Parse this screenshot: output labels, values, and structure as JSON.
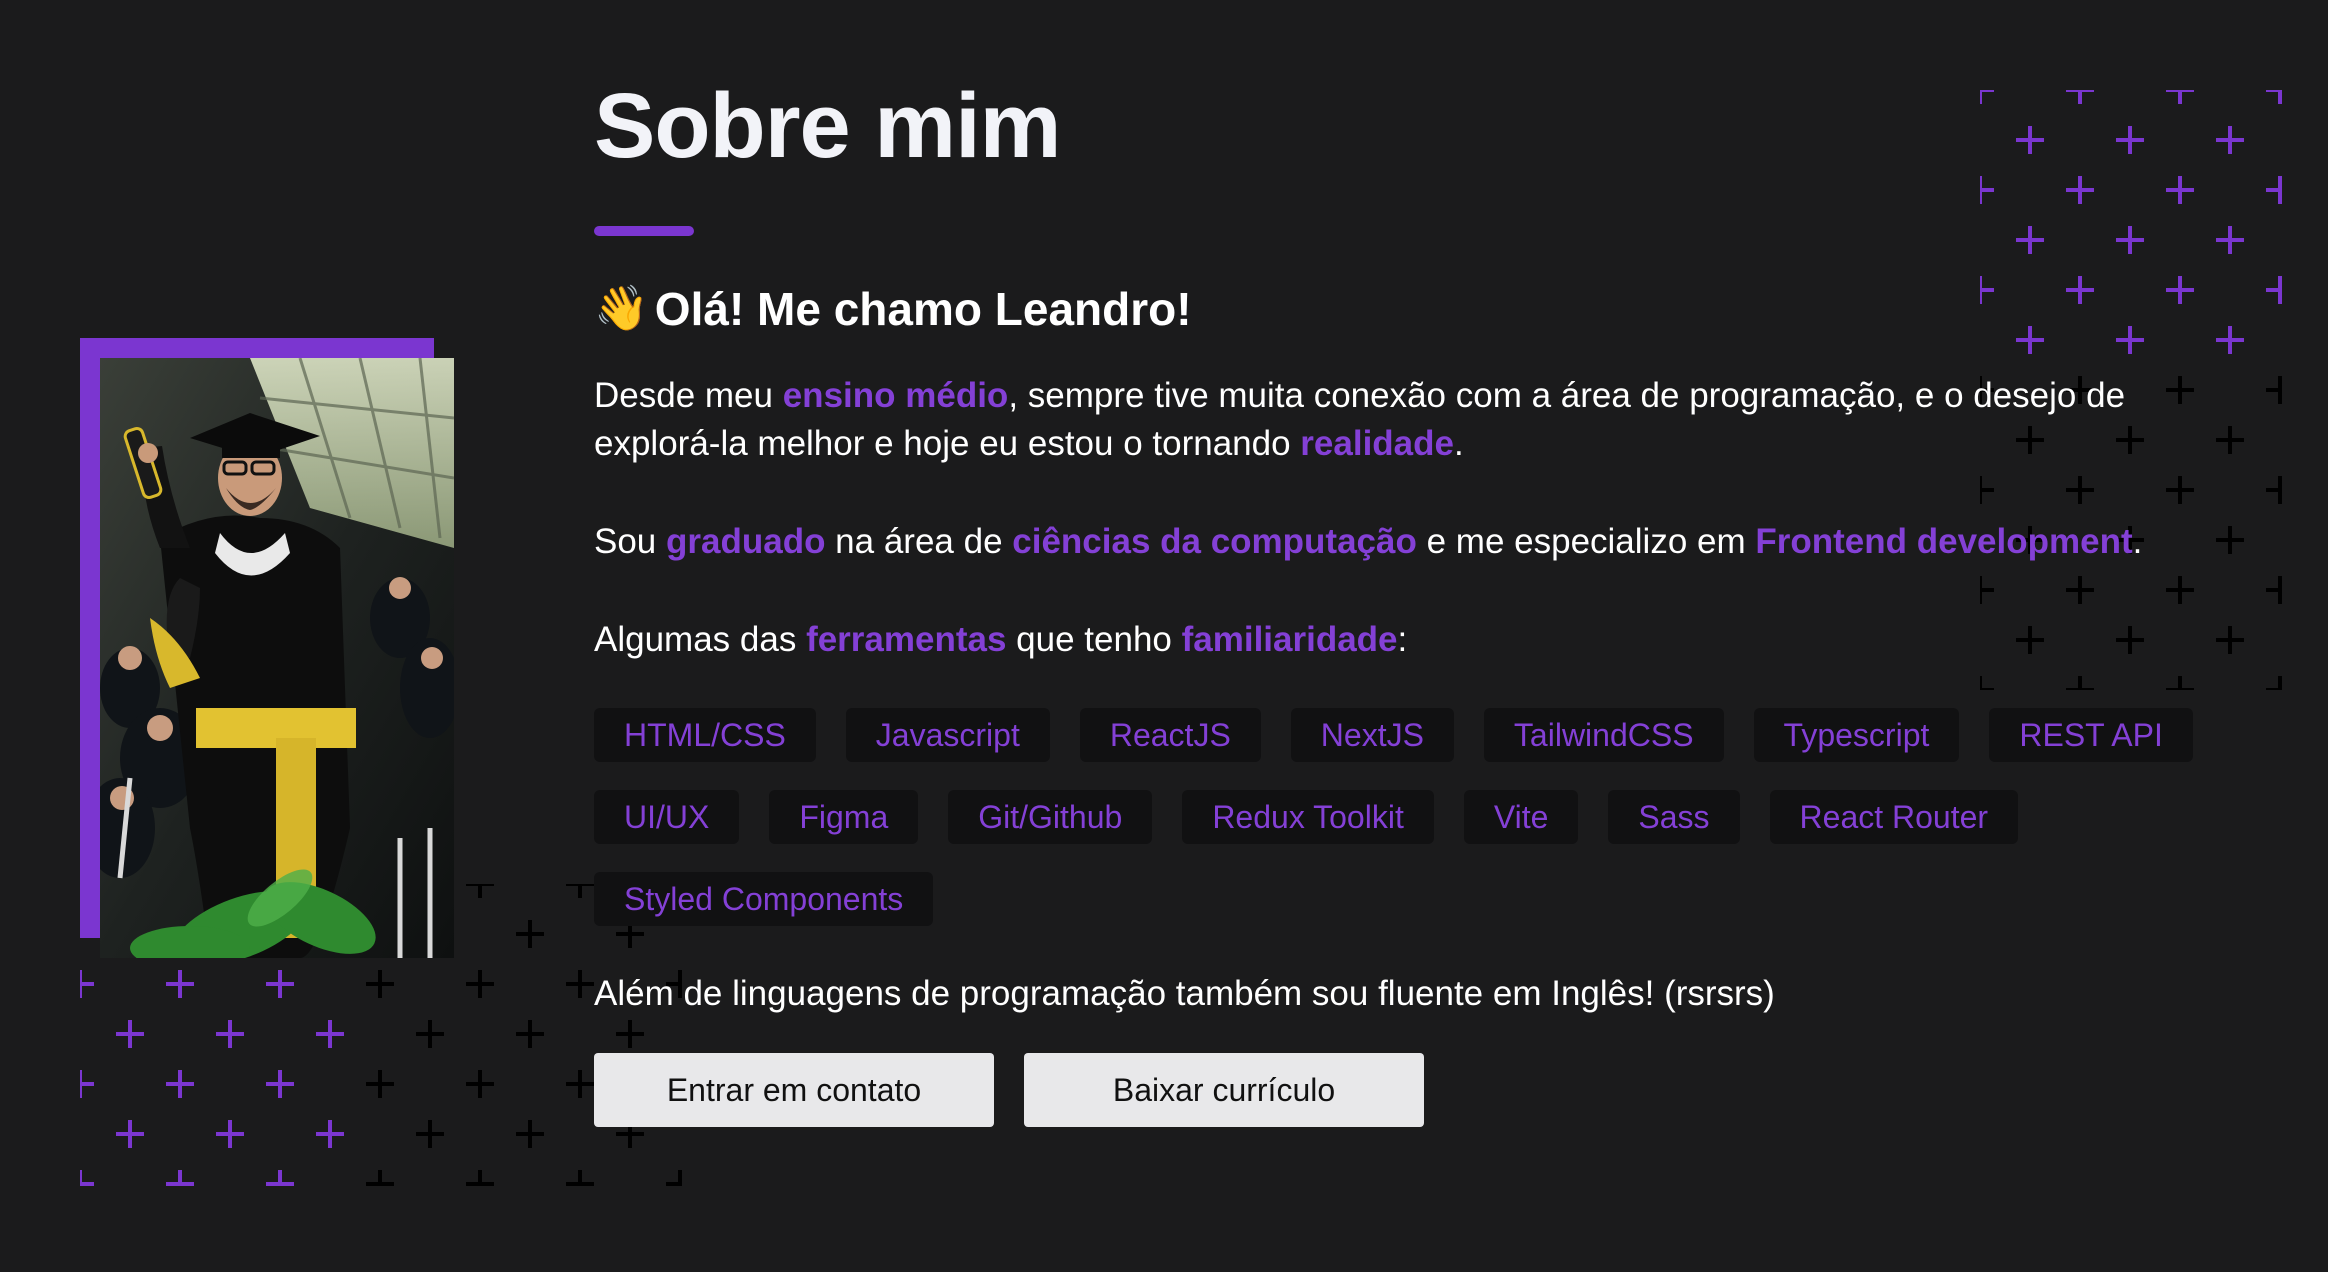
{
  "about": {
    "title": "Sobre mim",
    "greeting_emoji": "👋",
    "greeting": "Olá! Me chamo Leandro!",
    "p1": {
      "t1": "Desde meu ",
      "h1": "ensino médio",
      "t2": ", sempre tive muita conexão com a área de programação, e o desejo de explorá-la melhor e hoje eu estou o tornando ",
      "h2": "realidade",
      "t3": "."
    },
    "p2": {
      "t1": "Sou ",
      "h1": "graduado",
      "t2": " na área de ",
      "h2": "ciências da computação",
      "t3": " e me especializo em ",
      "h3": "Frontend development",
      "t4": "."
    },
    "p3": {
      "t1": "Algumas das ",
      "h1": "ferramentas",
      "t2": " que tenho ",
      "h2": "familiaridade",
      "t3": ":"
    },
    "tools": [
      "HTML/CSS",
      "Javascript",
      "ReactJS",
      "NextJS",
      "TailwindCSS",
      "Typescript",
      "REST API",
      "UI/UX",
      "Figma",
      "Git/Github",
      "Redux Toolkit",
      "Vite",
      "Sass",
      "React Router",
      "Styled Components"
    ],
    "languages_note": "Além de linguagens de programação também sou fluente em Inglês! (rsrsrs)",
    "contact_button": "Entrar em contato",
    "cv_button": "Baixar currículo"
  },
  "colors": {
    "accent": "#7b36d0",
    "highlight_text": "#8440d6",
    "background": "#1b1b1c",
    "tag_background": "#111112",
    "button_background": "#e8e8ea"
  },
  "icons": {
    "decorative_pattern": "plus-grid-pattern",
    "greeting": "waving-hand-emoji"
  }
}
